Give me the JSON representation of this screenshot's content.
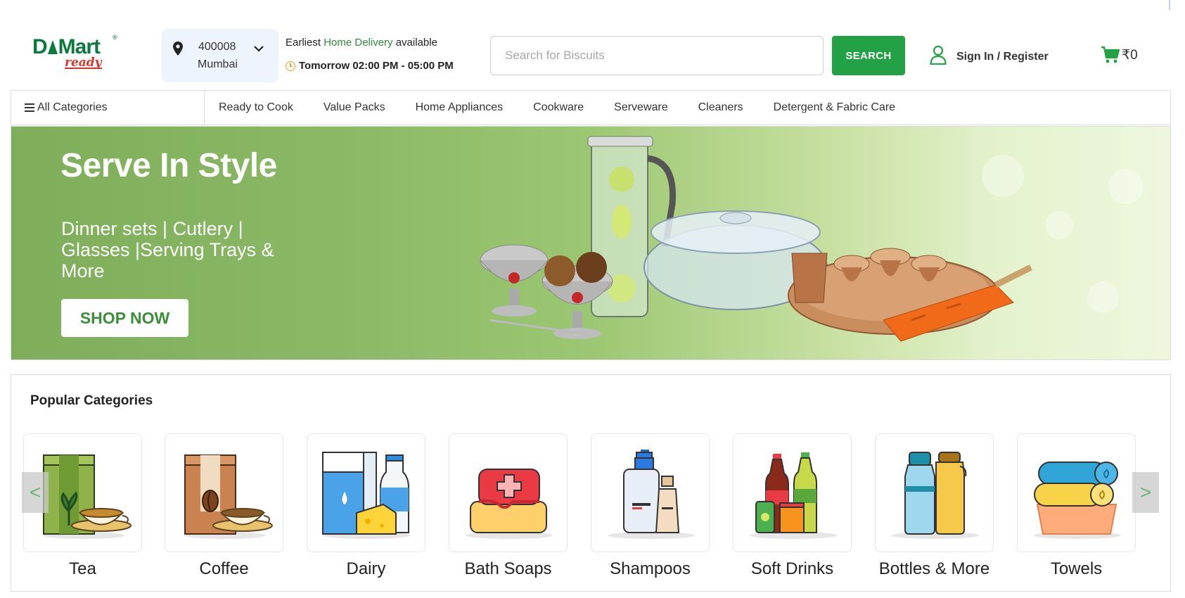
{
  "header": {
    "logo": {
      "brand_left": "D",
      "brand_right": "Mart",
      "registered": "®",
      "sub": "ready"
    },
    "location": {
      "pincode": "400008",
      "city": "Mumbai"
    },
    "delivery": {
      "prefix": "Earliest ",
      "highlight": "Home Delivery",
      "suffix": " available",
      "slot": "Tomorrow 02:00 PM - 05:00 PM"
    },
    "search": {
      "placeholder": "Search for Biscuits",
      "value": "",
      "button_label": "SEARCH"
    },
    "account": {
      "label": "Sign In / Register"
    },
    "cart": {
      "amount": "₹0"
    }
  },
  "nav": {
    "all_categories": "All Categories",
    "items": [
      "Ready to Cook",
      "Value Packs",
      "Home Appliances",
      "Cookware",
      "Serveware",
      "Cleaners",
      "Detergent & Fabric Care"
    ]
  },
  "banner": {
    "title": "Serve In Style",
    "subtitle": "Dinner sets | Cutlery | Glasses |Serving Trays & More",
    "cta": "SHOP NOW"
  },
  "popular": {
    "heading": "Popular Categories",
    "prev_arrow": "<",
    "next_arrow": ">",
    "categories": [
      {
        "name": "Tea",
        "icon": "tea-icon"
      },
      {
        "name": "Coffee",
        "icon": "coffee-icon"
      },
      {
        "name": "Dairy",
        "icon": "dairy-icon"
      },
      {
        "name": "Bath Soaps",
        "icon": "bath-soaps-icon"
      },
      {
        "name": "Shampoos",
        "icon": "shampoos-icon"
      },
      {
        "name": "Soft Drinks",
        "icon": "soft-drinks-icon"
      },
      {
        "name": "Bottles & More",
        "icon": "bottles-icon"
      },
      {
        "name": "Towels",
        "icon": "towels-icon"
      }
    ]
  },
  "colors": {
    "brand_green": "#0c7a3e",
    "accent_green": "#22a244",
    "brand_red": "#e2322c",
    "clock_orange": "#f39c12"
  }
}
